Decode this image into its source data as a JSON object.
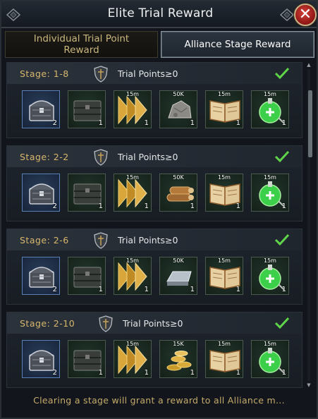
{
  "window": {
    "title": "Elite Trial Reward",
    "close_label": "✕"
  },
  "tabs": [
    {
      "label_line1": "Individual Trial Point",
      "label_line2": "Reward",
      "selected": false
    },
    {
      "label": "Alliance Stage Reward",
      "selected": true
    }
  ],
  "rewards": [
    {
      "stage": "Stage: 1-8",
      "requirement": "Trial Points≥0",
      "claimed": true,
      "items": [
        {
          "icon": "silver-chest-icon",
          "qty": "2"
        },
        {
          "icon": "dark-chest-icon",
          "qty": "1"
        },
        {
          "icon": "speedup-arrows-icon",
          "tag": "15m",
          "qty": "1"
        },
        {
          "icon": "stone-ore-icon",
          "tag": "50K",
          "qty": "1"
        },
        {
          "icon": "open-book-icon",
          "tag": "15m",
          "qty": "1"
        },
        {
          "icon": "green-heal-potion-icon",
          "tag": "15m",
          "qty": "1"
        }
      ]
    },
    {
      "stage": "Stage: 2-2",
      "requirement": "Trial Points≥0",
      "claimed": true,
      "items": [
        {
          "icon": "silver-chest-icon",
          "qty": "2"
        },
        {
          "icon": "dark-chest-icon",
          "qty": "1"
        },
        {
          "icon": "speedup-arrows-icon",
          "tag": "15m",
          "qty": "1"
        },
        {
          "icon": "wood-logs-icon",
          "tag": "50K",
          "qty": "1"
        },
        {
          "icon": "open-book-icon",
          "tag": "15m",
          "qty": "1"
        },
        {
          "icon": "green-heal-potion-icon",
          "tag": "15m",
          "qty": "1"
        }
      ]
    },
    {
      "stage": "Stage: 2-6",
      "requirement": "Trial Points≥0",
      "claimed": true,
      "items": [
        {
          "icon": "silver-chest-icon",
          "qty": "2"
        },
        {
          "icon": "dark-chest-icon",
          "qty": "1"
        },
        {
          "icon": "speedup-arrows-icon",
          "tag": "15m",
          "qty": "1"
        },
        {
          "icon": "iron-ingot-icon",
          "tag": "50K",
          "qty": "1"
        },
        {
          "icon": "open-book-icon",
          "tag": "15m",
          "qty": "1"
        },
        {
          "icon": "green-heal-potion-icon",
          "tag": "15m",
          "qty": "1"
        }
      ]
    },
    {
      "stage": "Stage: 2-10",
      "requirement": "Trial Points≥0",
      "claimed": true,
      "items": [
        {
          "icon": "silver-chest-icon",
          "qty": "2"
        },
        {
          "icon": "dark-chest-icon",
          "qty": "1"
        },
        {
          "icon": "speedup-arrows-icon",
          "tag": "15m",
          "qty": "1"
        },
        {
          "icon": "gold-coins-icon",
          "tag": "15K",
          "qty": "1"
        },
        {
          "icon": "open-book-icon",
          "tag": "15m",
          "qty": "1"
        },
        {
          "icon": "green-heal-potion-icon",
          "tag": "15m",
          "qty": "1"
        }
      ]
    }
  ],
  "footer": "Clearing a stage will grant a reward to all Alliance m..."
}
